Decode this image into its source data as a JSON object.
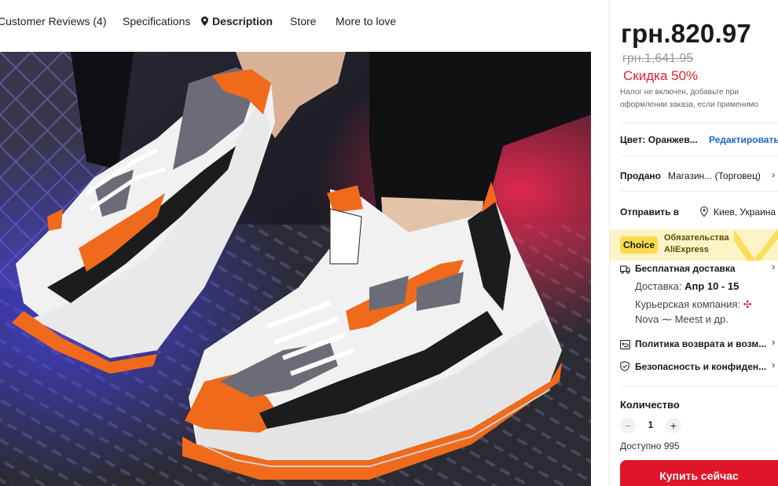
{
  "tabs": [
    {
      "label": "Customer Reviews (4)"
    },
    {
      "label": "Specifications"
    },
    {
      "label": "Description"
    },
    {
      "label": "Store"
    },
    {
      "label": "More to love"
    }
  ],
  "product": {
    "price": "грн.820.97",
    "old_price": "грн.1,641.95",
    "discount": "Скидка 50%",
    "tax_note": "Налог не включен, добавьте при оформлении заказа, если применимо"
  },
  "color_row": {
    "label": "Цвет:",
    "value": "Оранжев...",
    "action": "Редактировать"
  },
  "seller_row": {
    "label": "Продано",
    "value": "Магазин... (Торговец)"
  },
  "ship_row": {
    "label": "Отправить в",
    "value": "Киев, Украина"
  },
  "choice": {
    "badge": "Choice",
    "text": "Обязательства AliExpress"
  },
  "shipping": {
    "title": "Бесплатная доставка",
    "delivery_label": "Доставка:",
    "delivery_dates": "Апр 10 - 15",
    "courier_label": "Курьерская компания:",
    "courier_value": "Nova ⁓ Meest и др."
  },
  "returns": {
    "title": "Политика возврата и возм..."
  },
  "security": {
    "title": "Безопасность и конфиден..."
  },
  "quantity": {
    "label": "Количество",
    "minus": "−",
    "value": "1",
    "plus": "+",
    "available": "Доступно 995"
  },
  "buy_button": "Купить сейчас",
  "colors": {
    "accent": "#e0152a",
    "discount": "#e1202e",
    "link": "#1e63c9",
    "choice_bg": "#fdf3c7",
    "choice_badge": "#f9db4b"
  }
}
